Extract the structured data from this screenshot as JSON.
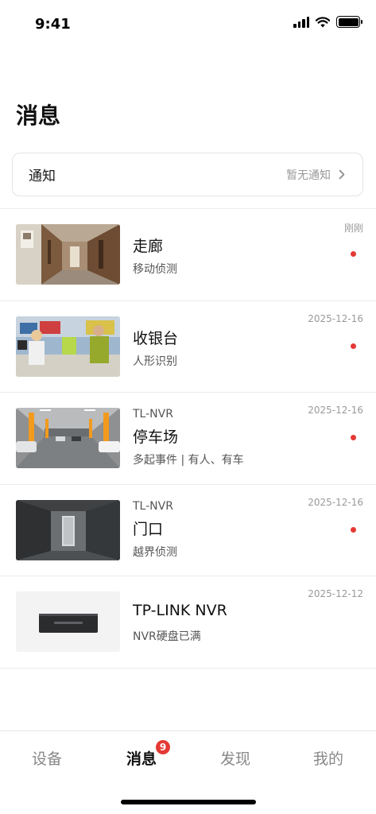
{
  "status_bar": {
    "time": "9:41"
  },
  "page": {
    "title": "消息"
  },
  "notice": {
    "label": "通知",
    "status": "暂无通知"
  },
  "messages": [
    {
      "source": "",
      "title": "走廊",
      "subtitle": "移动侦测",
      "time": "刚刚",
      "unread": true,
      "thumb": "corridor"
    },
    {
      "source": "",
      "title": "收银台",
      "subtitle": "人形识别",
      "time": "2025-12-16",
      "unread": true,
      "thumb": "cashier"
    },
    {
      "source": "TL-NVR",
      "title": "停车场",
      "subtitle": "多起事件 | 有人、有车",
      "time": "2025-12-16",
      "unread": true,
      "thumb": "parking"
    },
    {
      "source": "TL-NVR",
      "title": "门口",
      "subtitle": "越界侦测",
      "time": "2025-12-16",
      "unread": true,
      "thumb": "doorway"
    },
    {
      "source": "",
      "title": "TP-LINK NVR",
      "subtitle": "NVR硬盘已满",
      "time": "2025-12-12",
      "unread": false,
      "thumb": "nvr-device"
    }
  ],
  "tabs": [
    {
      "label": "设备",
      "active": false
    },
    {
      "label": "消息",
      "active": true,
      "badge": "9"
    },
    {
      "label": "发现",
      "active": false
    },
    {
      "label": "我的",
      "active": false
    }
  ],
  "colors": {
    "accent_red": "#e53935",
    "text_primary": "#111111",
    "text_secondary": "#555555",
    "text_muted": "#999999"
  }
}
